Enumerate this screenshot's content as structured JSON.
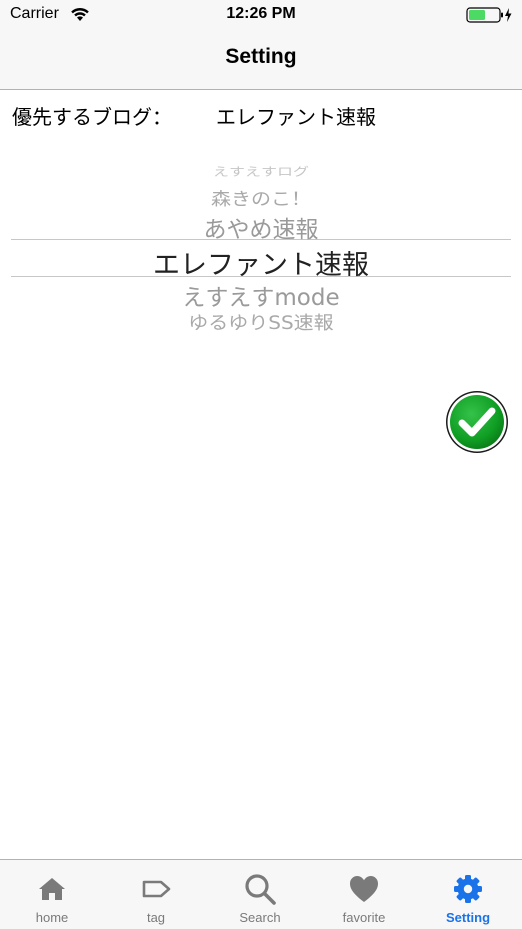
{
  "status_bar": {
    "carrier": "Carrier",
    "time": "12:26 PM",
    "battery_level": 0.55
  },
  "nav": {
    "title": "Setting"
  },
  "preference": {
    "label": "優先するブログ：",
    "value": "エレファント速報"
  },
  "picker": {
    "items": [
      "えすえすログ",
      "森きのこ！",
      "あやめ速報",
      "エレファント速報",
      "えすえすmode",
      "ゆるゆりSS速報"
    ],
    "selected_index": 3
  },
  "confirm": {
    "icon": "checkmark-icon",
    "color": "#0f9d23"
  },
  "tab_bar": {
    "active_color": "#1a73e8",
    "inactive_color": "#7a7a7a",
    "tabs": [
      {
        "label": "home",
        "icon": "home-icon"
      },
      {
        "label": "tag",
        "icon": "tag-icon"
      },
      {
        "label": "Search",
        "icon": "search-icon"
      },
      {
        "label": "favorite",
        "icon": "heart-icon"
      },
      {
        "label": "Setting",
        "icon": "gear-icon"
      }
    ],
    "active_index": 4
  }
}
